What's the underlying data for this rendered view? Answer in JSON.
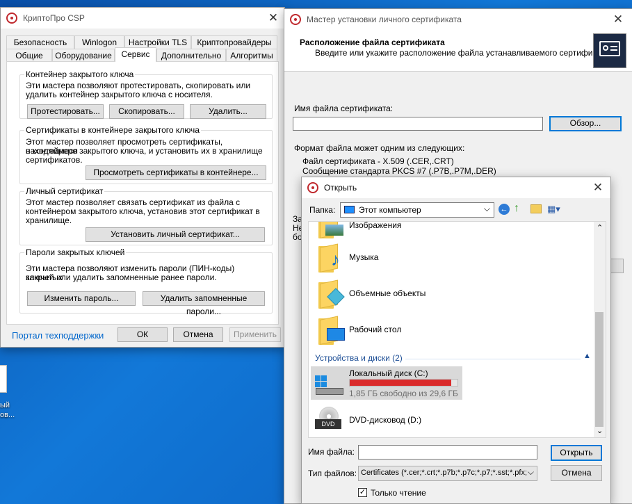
{
  "csp": {
    "title": "КриптоПро CSP",
    "tabs_row1": [
      "Безопасность",
      "Winlogon",
      "Настройки TLS",
      "Криптопровайдеры"
    ],
    "tabs_row2": [
      "Общие",
      "Оборудование",
      "Сервис",
      "Дополнительно",
      "Алгоритмы"
    ],
    "container": {
      "legend": "Контейнер закрытого ключа",
      "text1": "Эти мастера позволяют протестировать, скопировать или",
      "text2": "удалить контейнер закрытого ключа с носителя.",
      "btn_test": "Протестировать...",
      "btn_copy": "Скопировать...",
      "btn_delete": "Удалить..."
    },
    "certs": {
      "legend": "Сертификаты в контейнере закрытого ключа",
      "text1": "Этот мастер позволяет просмотреть сертификаты, находящиеся",
      "text2": "в контейнере закрытого ключа, и установить их в хранилище",
      "text3": "сертификатов.",
      "btn_view": "Просмотреть сертификаты в контейнере..."
    },
    "personal": {
      "legend": "Личный сертификат",
      "text1": "Этот мастер позволяет связать сертификат из файла с",
      "text2": "контейнером закрытого ключа, установив этот сертификат в",
      "text3": "хранилище.",
      "btn_install": "Установить личный сертификат..."
    },
    "passwords": {
      "legend": "Пароли закрытых ключей",
      "text1": "Эти мастера позволяют изменить пароли (ПИН-коды) закрытых",
      "text2": "ключей или удалить запомненные ранее пароли.",
      "btn_change": "Изменить пароль...",
      "btn_forget": "Удалить запомненные пароли..."
    },
    "support_link": "Портал техподдержки",
    "ok": "ОК",
    "cancel": "Отмена",
    "apply": "Применить"
  },
  "wizard": {
    "title": "Мастер установки личного сертификата",
    "header": "Расположение файла сертификата",
    "subheader": "Введите или укажите расположение файла устанавливаемого сертификата",
    "file_label": "Имя файла сертификата:",
    "file_value": "",
    "browse": "Обзор...",
    "formats_label": "Формат файла может одним из следующих:",
    "format1": "Файл сертификата - X.509 (.CER,.CRT)",
    "format2": "Сообщение стандарта PKCS #7 (.P7B,.P7M,.DER)",
    "hidden1": "За",
    "hidden2": "Не",
    "hidden3": "бо"
  },
  "open": {
    "title": "Открыть",
    "folder_label": "Папка:",
    "folder_value": "Этот компьютер",
    "items": [
      "Изображения",
      "Музыка",
      "Объемные объекты",
      "Рабочий стол"
    ],
    "section": "Устройства и диски (2)",
    "drive_c": {
      "name": "Локальный диск (C:)",
      "free": "1,85 ГБ свободно из 29,6 ГБ",
      "used_fraction": 0.94
    },
    "drive_d": {
      "name": "DVD-дисковод (D:)",
      "icon_text": "DVD"
    },
    "filename_label": "Имя файла:",
    "filename_value": "",
    "filetype_label": "Тип файлов:",
    "filetype_value": "Certificates (*.cer;*.crt;*.p7b;*.p7c;*.p7;*.sst;*.pfx;*",
    "readonly": "Только чтение",
    "open_btn": "Открыть",
    "cancel_btn": "Отмена"
  },
  "desktop": {
    "icon_label1": "ый",
    "icon_label2": "ов..."
  },
  "colors": {
    "accent": "#0078d7",
    "link": "#0066cc",
    "disk_bar": "#da2a2a",
    "crypto_red": "#c0282d"
  }
}
